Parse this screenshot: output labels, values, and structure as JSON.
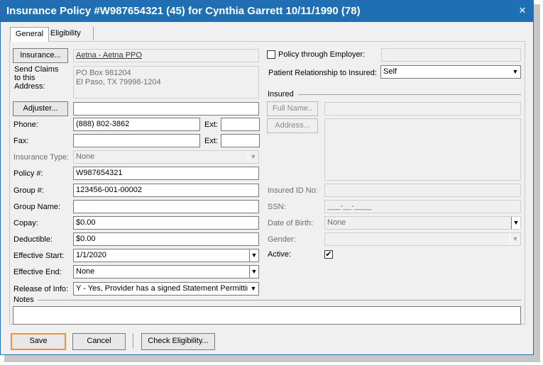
{
  "window": {
    "title": "Insurance Policy #W987654321 (45)  for Cynthia Garrett 10/11/1990 (78)",
    "close_glyph": "✕"
  },
  "tabs": [
    {
      "label": "General",
      "active": true
    },
    {
      "label": "Eligibility",
      "active": false
    }
  ],
  "left": {
    "insurance_button": "Insurance...",
    "insurance_value": "Aetna - Aetna PPO",
    "send_claims_label": "Send Claims to this Address:",
    "address_line1": "PO Box 981204",
    "address_line2": "El Paso, TX 79998-1204",
    "adjuster_button": "Adjuster...",
    "adjuster_value": "",
    "phone_label": "Phone:",
    "phone_value": "(888) 802-3862",
    "phone_ext_label": "Ext:",
    "phone_ext_value": "",
    "fax_label": "Fax:",
    "fax_value": "",
    "fax_ext_label": "Ext:",
    "fax_ext_value": "",
    "insurance_type_label": "Insurance Type:",
    "insurance_type_value": "None",
    "policy_label": "Policy #:",
    "policy_value": "W987654321",
    "group_label": "Group #:",
    "group_value": "123456-001-00002",
    "group_name_label": "Group Name:",
    "group_name_value": "",
    "copay_label": "Copay:",
    "copay_value": "$0.00",
    "deductible_label": "Deductible:",
    "deductible_value": "$0.00",
    "effective_start_label": "Effective Start:",
    "effective_start_value": "1/1/2020",
    "effective_end_label": "Effective End:",
    "effective_end_value": "None",
    "release_label": "Release of Info:",
    "release_value": "Y - Yes, Provider has a signed Statement Permitting"
  },
  "right": {
    "policy_through_employer_label": "Policy through Employer:",
    "policy_through_employer_checked": false,
    "employer_value": "",
    "relationship_label": "Patient Relationship to Insured:",
    "relationship_value": "Self",
    "insured_section": "Insured",
    "full_name_button": "Full Name..",
    "address_button": "Address...",
    "insured_id_label": "Insured ID No:",
    "insured_id_value": "",
    "ssn_label": "SSN:",
    "ssn_value": "___-__-____",
    "dob_label": "Date of Birth:",
    "dob_value": "None",
    "gender_label": "Gender:",
    "gender_value": "",
    "active_label": "Active:",
    "active_checked": true
  },
  "notes": {
    "label": "Notes",
    "value": ""
  },
  "footer": {
    "save": "Save",
    "cancel": "Cancel",
    "check_eligibility": "Check Eligibility..."
  },
  "glyphs": {
    "dropdown": "▼",
    "check": "✔"
  }
}
